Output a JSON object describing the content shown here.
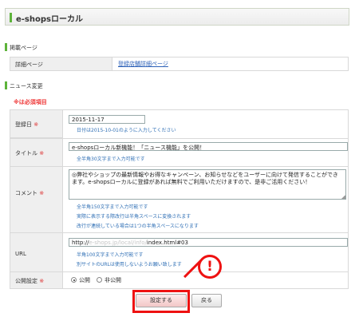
{
  "header": {
    "title": "e-shopsローカル"
  },
  "sections": {
    "posted_page": "掲載ページ",
    "news_change": "ニュース変更"
  },
  "detail": {
    "label": "詳細ページ",
    "link": "登録店舗詳細ページ"
  },
  "required_note": "※は必須項目",
  "form": {
    "date": {
      "label": "登録日",
      "required": "※",
      "value": "2015-11-17",
      "hint": "日付は2015-10-01のように入力してください"
    },
    "title": {
      "label": "タイトル",
      "required": "※",
      "value": "e-shopsローカル新機能！「ニュース機能」を公開！",
      "hint": "全半角30文字まで入力可能です"
    },
    "comment": {
      "label": "コメント",
      "required": "※",
      "value": "◎弊社やショップの最新情報やお得なキャンペーン、お知らせなどをユーザーに向けて発信することができます。e-shopsローカルに登録があれば無料でご利用いただけますので、是非ご活用ください！",
      "hints": [
        "全半角150文字まで入力可能です",
        "実際に表示する際改行は半角スペースに変換されます",
        "改行が連続している場合は1つの半角スペースになります"
      ]
    },
    "url": {
      "label": "URL",
      "value_prefix": "http://",
      "value_blurred": "e-shops.jp/local/info/",
      "value_suffix": "index.html#03",
      "hints": [
        "半角100文字まで入力可能です",
        "別サイトのURLは使用しないようお願い致します"
      ]
    },
    "publish": {
      "label": "公開設定",
      "required": "※",
      "options": [
        "公開",
        "非公開"
      ],
      "selected": "公開"
    }
  },
  "buttons": {
    "submit": "設定する",
    "back": "戻る"
  },
  "callout": {
    "symbol": "!"
  },
  "colors": {
    "accent_green": "#5db33a",
    "callout_red": "#e11111",
    "link_blue": "#2e62b8",
    "hint_blue": "#2f6fb5"
  }
}
